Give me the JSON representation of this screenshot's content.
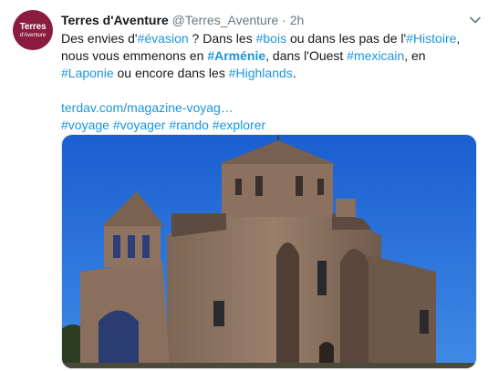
{
  "author": {
    "avatar_line1": "Terres",
    "avatar_line2": "d'Aventure",
    "name": "Terres d'Aventure",
    "handle": "@Terres_Aventure",
    "separator": "·",
    "time": "2h"
  },
  "tweet": {
    "line1_a": "Des envies d'",
    "tag_evasion": "#évasion",
    "line1_b": " ? Dans les ",
    "tag_bois": "#bois",
    "line1_c": " ou dans les pas de l'",
    "tag_histoire": "#Histoire",
    "line1_d": ", nous vous emmenons en ",
    "tag_armenie": "#Arménie",
    "line1_e": ", dans l'Ouest ",
    "tag_mexicain": "#mexicain",
    "line1_f": ", en ",
    "tag_laponie": "#Laponie",
    "line1_g": " ou encore dans les ",
    "tag_highlands": "#Highlands",
    "line1_h": ".",
    "link": "terdav.com/magazine-voyag…",
    "tags": [
      "#voyage",
      "#voyager",
      "#rando",
      "#explorer"
    ]
  },
  "colors": {
    "link": "#1b95e0",
    "avatar_bg": "#8a1c3f",
    "sky": "#1f6fd6"
  },
  "icons": {
    "caret": "chevron-down-icon"
  }
}
